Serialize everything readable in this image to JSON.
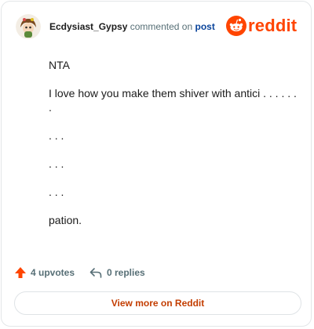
{
  "header": {
    "username": "Ecdysiast_Gypsy",
    "commented_text": "commented on",
    "post_link": "post",
    "brand": "reddit",
    "avatar_icon": "user-avatar-icon",
    "brand_icon": "reddit-snoo-icon"
  },
  "comment": {
    "paragraphs": [
      "NTA",
      "I love how you make them shiver with antici . . . . . . .",
      ". . .",
      ". . .",
      ". . .",
      "pation."
    ]
  },
  "footer": {
    "upvotes": "4 upvotes",
    "replies": "0 replies",
    "upvote_icon": "upvote-arrow-icon",
    "reply_icon": "reply-arrow-icon"
  },
  "cta": {
    "label": "View more on Reddit"
  },
  "colors": {
    "brand": "#ff4500",
    "link": "#0a449b",
    "cta_text": "#c33d00",
    "muted": "#576f76"
  }
}
